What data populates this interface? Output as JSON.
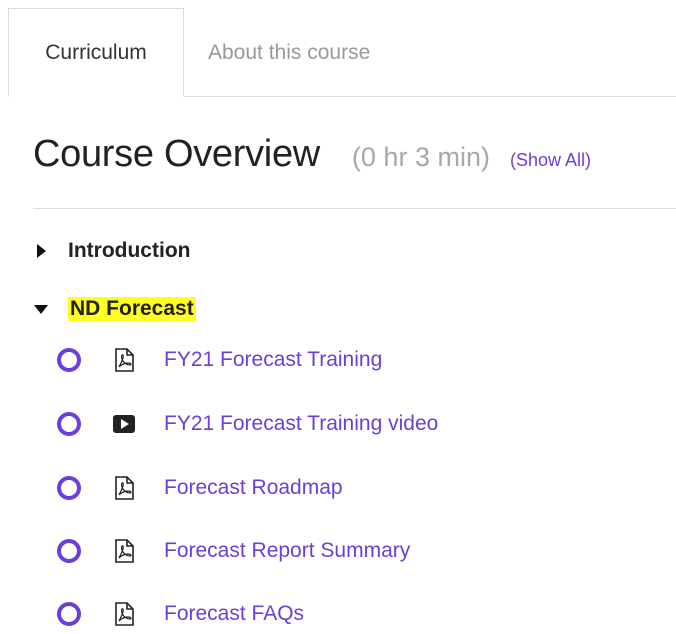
{
  "tabs": [
    {
      "label": "Curriculum",
      "active": true
    },
    {
      "label": "About this course",
      "active": false
    }
  ],
  "overview": {
    "title": "Course Overview",
    "duration": "(0 hr 3 min)",
    "show_all": "(Show All)"
  },
  "sections": [
    {
      "label": "Introduction",
      "expanded": false,
      "highlighted": false
    },
    {
      "label": "ND Forecast",
      "expanded": true,
      "highlighted": true
    }
  ],
  "items": [
    {
      "label": "FY21 Forecast Training",
      "type_icon": "pdf-icon"
    },
    {
      "label": "FY21 Forecast Training video",
      "type_icon": "video-icon"
    },
    {
      "label": "Forecast Roadmap",
      "type_icon": "pdf-icon"
    },
    {
      "label": "Forecast Report Summary",
      "type_icon": "pdf-icon"
    },
    {
      "label": "Forecast FAQs",
      "type_icon": "pdf-icon"
    }
  ],
  "colors": {
    "accent": "#6b3fd8",
    "highlight": "#ffff22",
    "border": "#dcdcdc"
  }
}
